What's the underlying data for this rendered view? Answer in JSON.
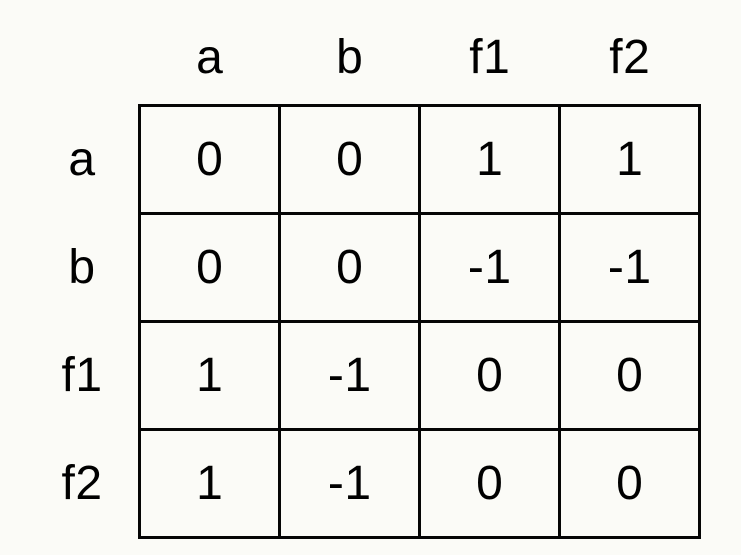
{
  "headers": {
    "cols": [
      "a",
      "b",
      "f1",
      "f2"
    ],
    "rows": [
      "a",
      "b",
      "f1",
      "f2"
    ]
  },
  "cells": {
    "r0": {
      "c0": "0",
      "c1": "0",
      "c2": "1",
      "c3": "1"
    },
    "r1": {
      "c0": "0",
      "c1": "0",
      "c2": "-1",
      "c3": "-1"
    },
    "r2": {
      "c0": "1",
      "c1": "-1",
      "c2": "0",
      "c3": "0"
    },
    "r3": {
      "c0": "1",
      "c1": "-1",
      "c2": "0",
      "c3": "0"
    }
  },
  "chart_data": {
    "type": "table",
    "title": "",
    "row_labels": [
      "a",
      "b",
      "f1",
      "f2"
    ],
    "col_labels": [
      "a",
      "b",
      "f1",
      "f2"
    ],
    "values": [
      [
        0,
        0,
        1,
        1
      ],
      [
        0,
        0,
        -1,
        -1
      ],
      [
        1,
        -1,
        0,
        0
      ],
      [
        1,
        -1,
        0,
        0
      ]
    ]
  }
}
